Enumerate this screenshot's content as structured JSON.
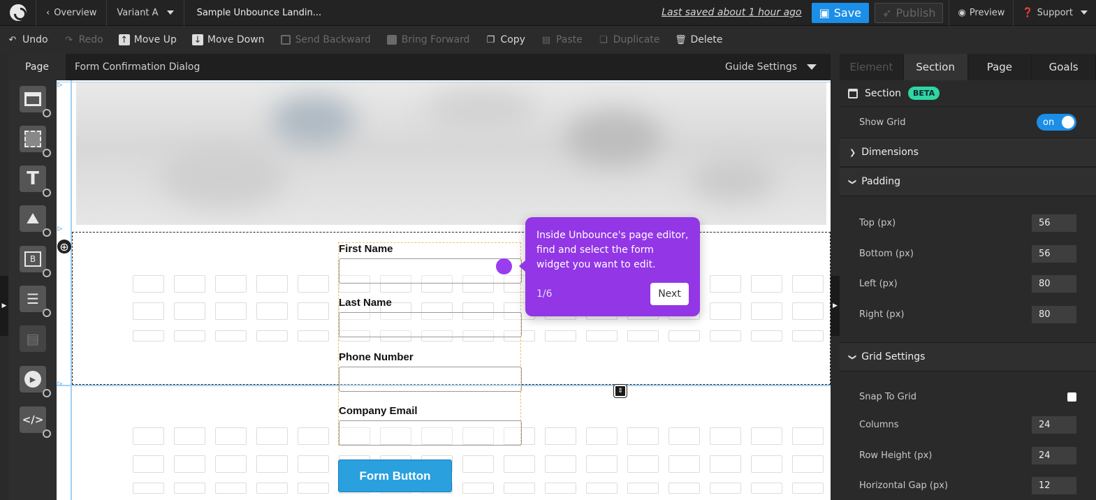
{
  "topbar": {
    "overview": "Overview",
    "variant": "Variant A",
    "page_title": "Sample Unbounce Landin...",
    "last_saved": "Last saved about 1 hour ago",
    "save": "Save",
    "publish": "Publish",
    "preview": "Preview",
    "support": "Support"
  },
  "toolbar": {
    "undo": "Undo",
    "redo": "Redo",
    "move_up": "Move Up",
    "move_down": "Move Down",
    "send_backward": "Send Backward",
    "bring_forward": "Bring Forward",
    "copy": "Copy",
    "paste": "Paste",
    "duplicate": "Duplicate",
    "delete": "Delete"
  },
  "canvas_head": {
    "page_tab": "Page",
    "dialog_title": "Form Confirmation Dialog",
    "guide_settings": "Guide Settings"
  },
  "palette": [
    "section-icon",
    "box-icon",
    "text-icon",
    "image-icon",
    "button-icon",
    "form-icon",
    "lightbox-icon",
    "video-icon",
    "code-icon"
  ],
  "form": {
    "fields": [
      "First Name",
      "Last Name",
      "Phone Number",
      "Company Email"
    ],
    "button": "Form Button"
  },
  "tooltip": {
    "text": "Inside Unbounce's page editor, find and select the form widget you want to edit.",
    "step": "1/6",
    "next": "Next"
  },
  "panel": {
    "tabs": [
      "Element",
      "Section",
      "Page",
      "Goals"
    ],
    "section_label": "Section",
    "beta": "BETA",
    "show_grid": "Show Grid",
    "toggle": "on",
    "dimensions": "Dimensions",
    "padding": "Padding",
    "padding_fields": [
      {
        "label": "Top (px)",
        "value": "56"
      },
      {
        "label": "Bottom (px)",
        "value": "56"
      },
      {
        "label": "Left (px)",
        "value": "80"
      },
      {
        "label": "Right (px)",
        "value": "80"
      }
    ],
    "grid_settings": "Grid Settings",
    "snap_to_grid": "Snap To Grid",
    "grid_fields": [
      {
        "label": "Columns",
        "value": "24"
      },
      {
        "label": "Row Height (px)",
        "value": "24"
      },
      {
        "label": "Horizontal Gap (px)",
        "value": "12"
      }
    ]
  },
  "colors": {
    "accent_blue": "#1b8ee8",
    "tooltip_purple": "#9236e6",
    "beta_green": "#2ed6a2",
    "form_button": "#2aa0de"
  }
}
